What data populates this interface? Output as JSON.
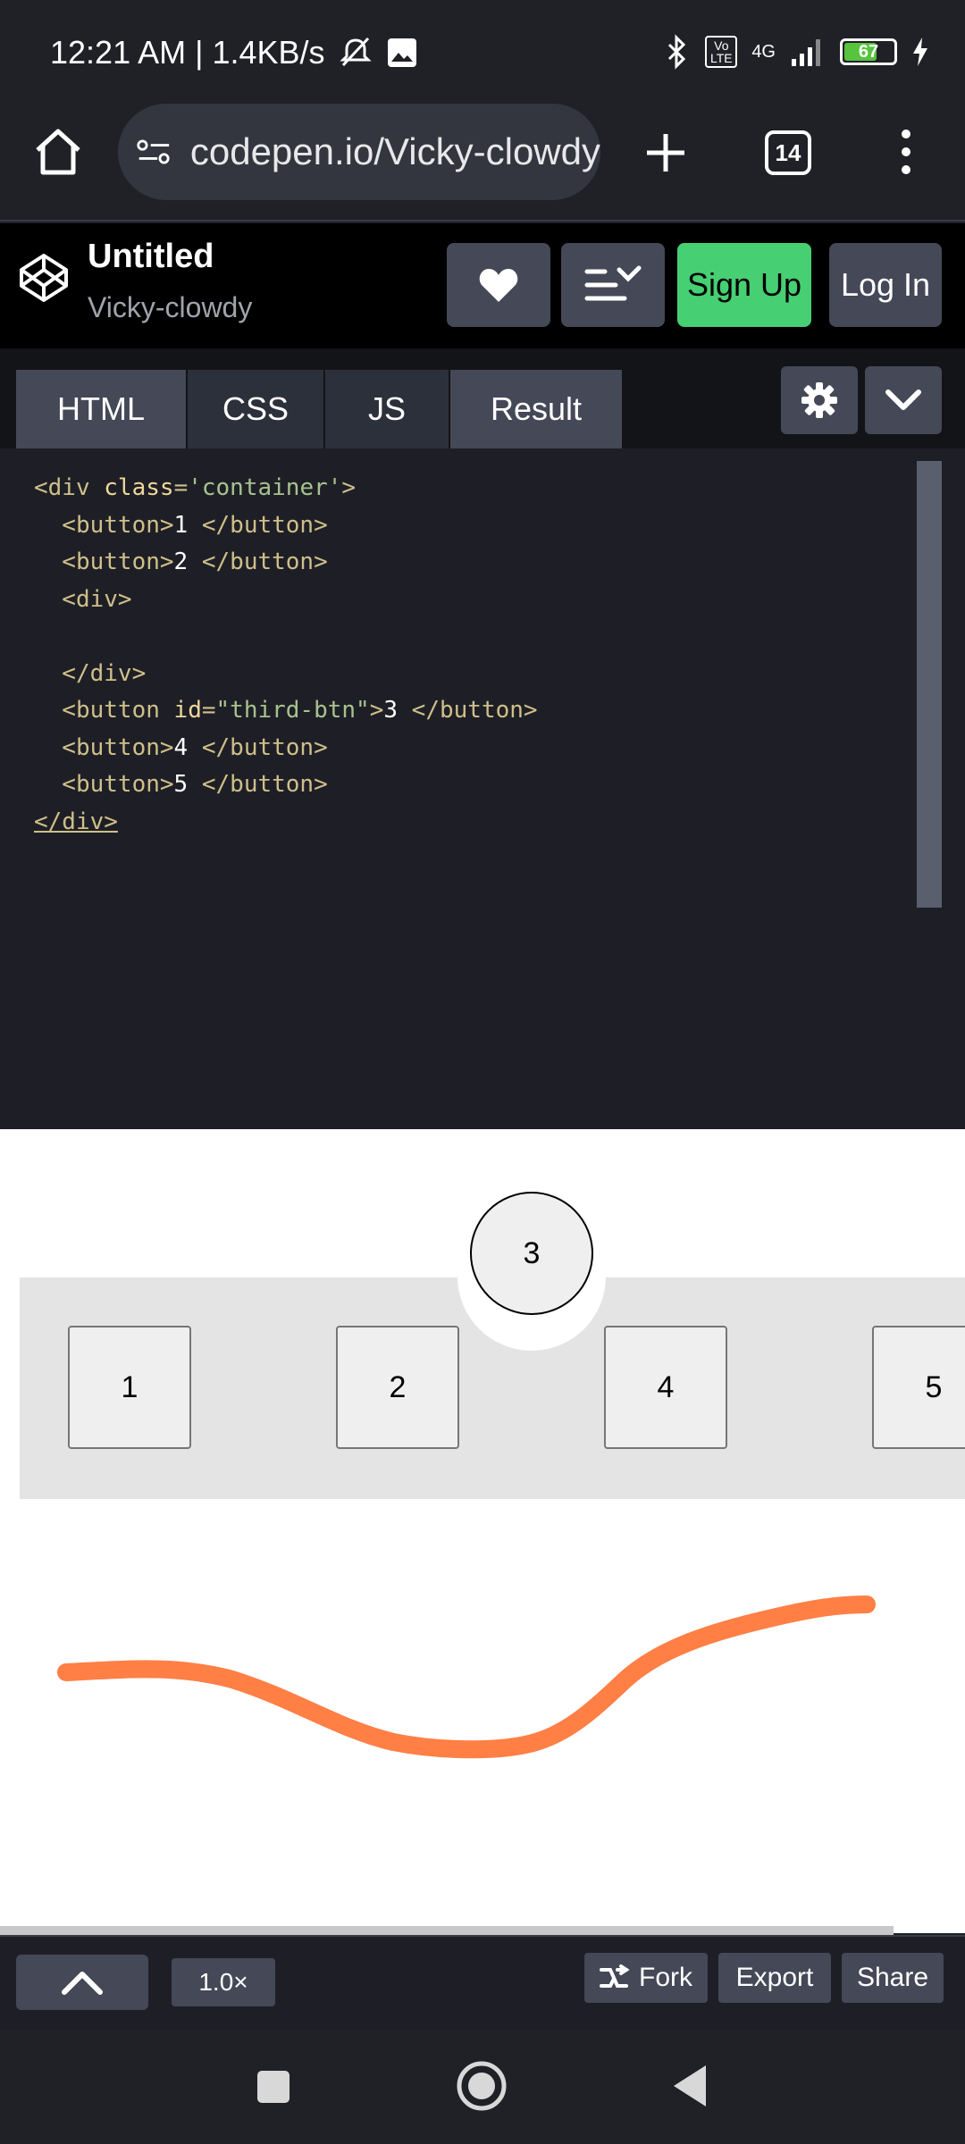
{
  "status_bar": {
    "time_speed": "12:21 AM | 1.4KB/s",
    "network": "4G",
    "volte": "Vo LTE",
    "battery": "67",
    "battery_level": 0.67
  },
  "browser": {
    "url": "codepen.io/Vicky-clowdy",
    "tab_count": "14"
  },
  "codepen": {
    "title": "Untitled",
    "user": "Vicky-clowdy",
    "signup_label": "Sign Up",
    "login_label": "Log In"
  },
  "editor": {
    "tabs": [
      "HTML",
      "CSS",
      "JS",
      "Result"
    ],
    "code": {
      "l1_tag_open": "<div ",
      "l1_attr": "class",
      "l1_eq": "=",
      "l1_val": "'container'",
      "l1_close": ">",
      "l2_open": "  <button>",
      "l2_text": "1 ",
      "l2_close": "</button>",
      "l3_open": "  <button>",
      "l3_text": "2 ",
      "l3_close": "</button>",
      "l4": "  <div>",
      "l5": "",
      "l6": "  </div>",
      "l7_open": "  <button ",
      "l7_attr": "id",
      "l7_eq": "=",
      "l7_val": "\"third-btn\"",
      "l7_gt": ">",
      "l7_text": "3 ",
      "l7_close": "</button>",
      "l8_open": "  <button>",
      "l8_text": "4 ",
      "l8_close": "</button>",
      "l9_open": "  <button>",
      "l9_text": "5 ",
      "l9_close": "</button>",
      "l10": "</div>"
    }
  },
  "result": {
    "buttons": [
      "1",
      "2",
      "3",
      "4",
      "5"
    ],
    "stroke_color": "#ff7f45"
  },
  "toolbar": {
    "zoom": "1.0×",
    "fork_label": "Fork",
    "export_label": "Export",
    "share_label": "Share"
  },
  "colors": {
    "accent_green": "#47cf73",
    "button_gray": "#444857"
  }
}
